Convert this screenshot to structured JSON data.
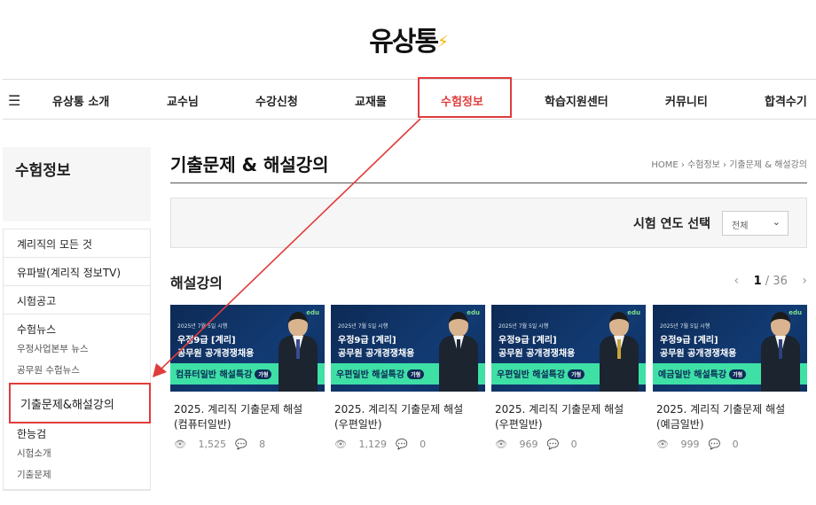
{
  "site": {
    "logo_text": "유상통"
  },
  "nav": {
    "menu_icon": "hamburger-icon",
    "items": [
      "유상통 소개",
      "교수님",
      "수강신청",
      "교재몰",
      "수험정보",
      "학습지원센터",
      "커뮤니티",
      "합격수기"
    ],
    "active_index": 4
  },
  "sidebar": {
    "title": "수험정보",
    "items": [
      {
        "label": "계리직의 모든 것"
      },
      {
        "label": "유파발(계리직 정보TV)"
      },
      {
        "label": "시험공고"
      }
    ],
    "groups": [
      {
        "label": "수험뉴스",
        "subs": [
          "우정사업본부 뉴스",
          "공무원 수험뉴스",
          "기출문제&해설강의"
        ]
      },
      {
        "label": "한능검",
        "subs": [
          "시험소개",
          "기출문제"
        ]
      }
    ],
    "active_sub": "기출문제&해설강의"
  },
  "main": {
    "page_title": "기출문제 & 해설강의",
    "breadcrumb": [
      "HOME",
      "수험정보",
      "기출문제 & 해설강의"
    ],
    "filter": {
      "label": "시험 연도 선택",
      "select_value": "전체"
    },
    "section_title": "해설강의",
    "pager": {
      "current": "1",
      "total": "36"
    }
  },
  "cards": [
    {
      "thumb_date": "2025년 7월 5일 시행",
      "thumb_line1": "우정9급 [계리]",
      "thumb_line2": "공무원 공개경쟁채용",
      "thumb_subject": "컴퓨터일반 해설특강",
      "thumb_tag": "가형",
      "thumb_brand": "edu",
      "title_line1": "2025. 계리직 기출문제 해설",
      "title_line2": "(컴퓨터일반)",
      "views": "1,525",
      "comments": "8",
      "tie_color": "#3b4a8f"
    },
    {
      "thumb_date": "2025년 7월 5일 시행",
      "thumb_line1": "우정9급 [계리]",
      "thumb_line2": "공무원 공개경쟁채용",
      "thumb_subject": "우편일반 해설특강",
      "thumb_tag": "가형",
      "thumb_brand": "edu",
      "title_line1": "2025. 계리직 기출문제 해설",
      "title_line2": "(우편일반)",
      "views": "1,129",
      "comments": "0",
      "tie_color": "#1c2430"
    },
    {
      "thumb_date": "2025년 7월 5일 시행",
      "thumb_line1": "우정9급 [계리]",
      "thumb_line2": "공무원 공개경쟁채용",
      "thumb_subject": "우편일반 해설특강",
      "thumb_tag": "가형",
      "thumb_brand": "edu",
      "title_line1": "2025. 계리직 기출문제 해설",
      "title_line2": "(우편일반)",
      "views": "969",
      "comments": "0",
      "tie_color": "#c9a43a"
    },
    {
      "thumb_date": "2025년 7월 5일 시행",
      "thumb_line1": "우정9급 [계리]",
      "thumb_line2": "공무원 공개경쟁채용",
      "thumb_subject": "예금일반 해설특강",
      "thumb_tag": "가형",
      "thumb_brand": "edu",
      "title_line1": "2025. 계리직 기출문제 해설",
      "title_line2": "(예금일반)",
      "views": "999",
      "comments": "0",
      "tie_color": "#2e3f7a"
    }
  ],
  "icons": {
    "views": "eye-icon",
    "comments": "comment-icon",
    "prev": "chevron-left-icon",
    "next": "chevron-right-icon"
  },
  "colors": {
    "accent": "#e03c3c",
    "thumb_band": "#3ee0a6",
    "thumb_bg": "#123b73"
  }
}
